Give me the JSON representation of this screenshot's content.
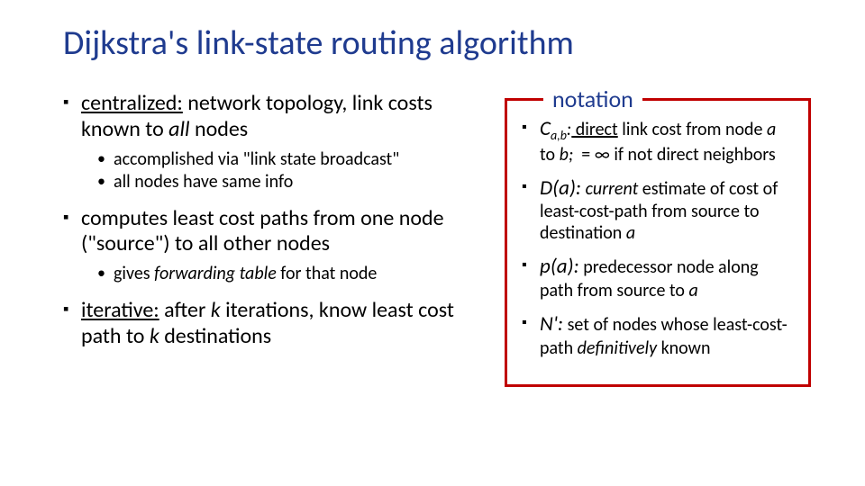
{
  "title": "Dijkstra's link-state routing algorithm",
  "left": {
    "b1": {
      "key": "centralized:",
      "rest1": " network topology, link costs known to ",
      "all": "all",
      "rest2": " nodes",
      "sub1": "accomplished via \"link state broadcast\"",
      "sub2": "all nodes have same info"
    },
    "b2": {
      "text": "computes least cost paths from one node (\"source\") to all other nodes",
      "sub1a": "gives ",
      "sub1i": "forwarding table",
      "sub1b": " for that node"
    },
    "b3": {
      "key": "iterative:",
      "rest1": " after ",
      "k1": "k",
      "rest2": " iterations, know least cost path to ",
      "k2": "k",
      "rest3": " destinations"
    }
  },
  "notation": {
    "label": "notation",
    "n1": {
      "term": "C",
      "sub": "a,b",
      "colon": ":",
      "u": " direct",
      "r1": " link cost from node ",
      "a": "a",
      "r2": " to ",
      "b": "b;",
      "r3": "  = ∞ if not direct neighbors"
    },
    "n2": {
      "term": "D(a):",
      "r1": " current",
      "r2": " estimate of cost of least-cost-path from source to destination ",
      "a": "a"
    },
    "n3": {
      "term": "p(a):",
      "r1": " predecessor node along path from source to ",
      "a": "a"
    },
    "n4": {
      "term": "N':",
      "r1": " set of nodes whose least-cost-path ",
      "d": "definitively",
      "r2": " known"
    }
  }
}
